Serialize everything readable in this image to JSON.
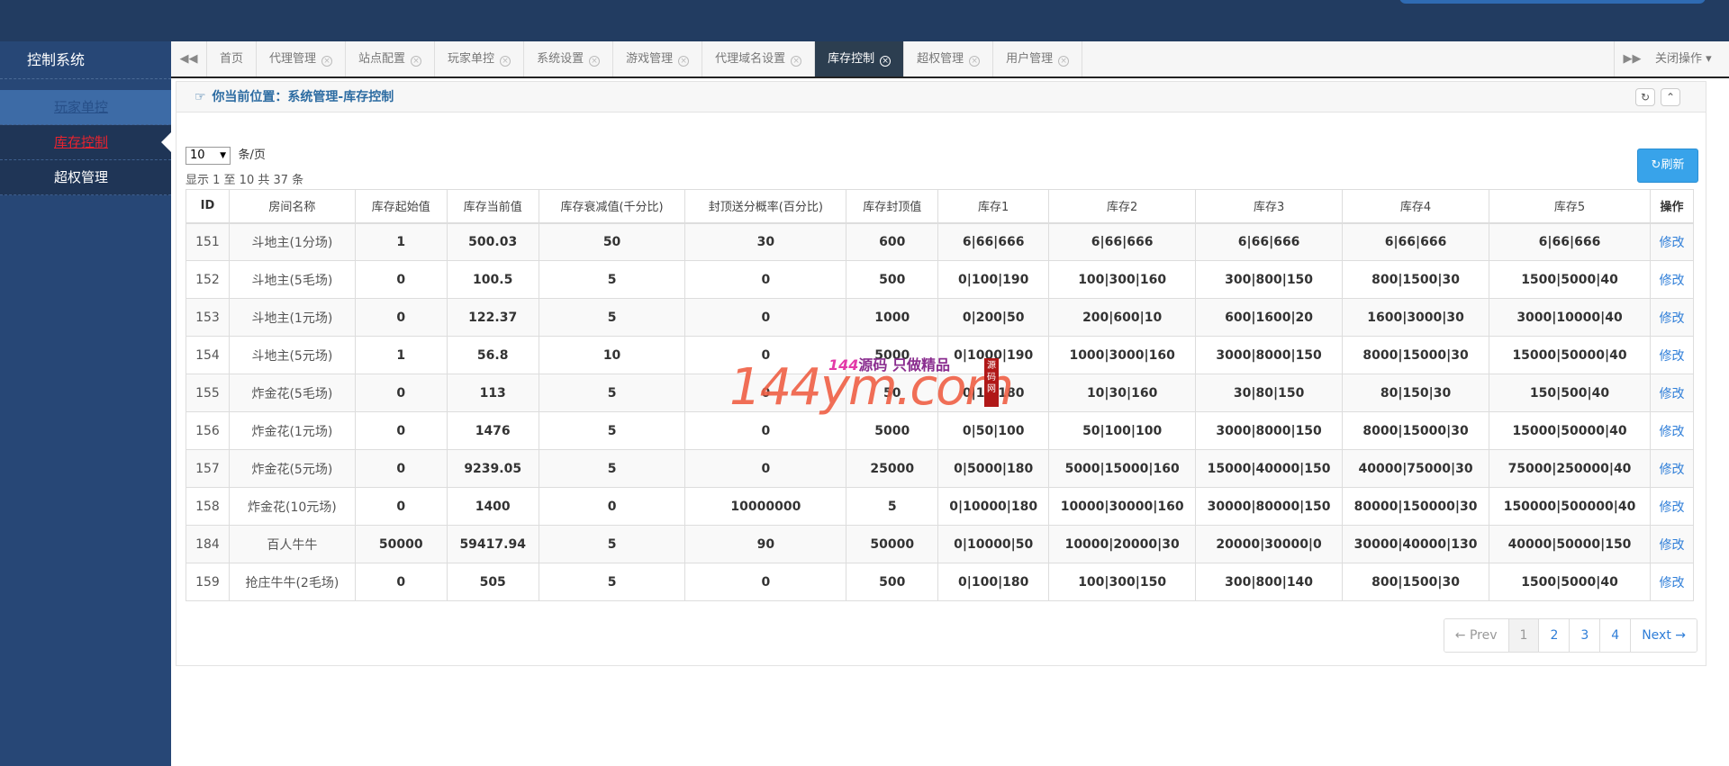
{
  "sidebar": {
    "title": "控制系统",
    "items": [
      {
        "label": "玩家单控"
      },
      {
        "label": "库存控制"
      },
      {
        "label": "超权管理"
      }
    ]
  },
  "tabs": {
    "items": [
      {
        "label": "首页"
      },
      {
        "label": "代理管理"
      },
      {
        "label": "站点配置"
      },
      {
        "label": "玩家单控"
      },
      {
        "label": "系统设置"
      },
      {
        "label": "游戏管理"
      },
      {
        "label": "代理域名设置"
      },
      {
        "label": "库存控制"
      },
      {
        "label": "超权管理"
      },
      {
        "label": "用户管理"
      }
    ],
    "close_ops": "关闭操作",
    "prev_icon": "double-left-arrow-icon",
    "next_icon": "double-right-arrow-icon"
  },
  "panel": {
    "breadcrumb": "你当前位置：系统管理-库存控制",
    "page_size": "10",
    "per_page": "条/页",
    "info": "显示 1 至 10 共 37 条",
    "refresh": "刷新"
  },
  "table": {
    "headers": [
      "ID",
      "房间名称",
      "库存起始值",
      "库存当前值",
      "库存衰减值(千分比)",
      "封顶送分概率(百分比)",
      "库存封顶值",
      "库存1",
      "库存2",
      "库存3",
      "库存4",
      "库存5",
      "操作"
    ],
    "rows": [
      [
        "151",
        "斗地主(1分场)",
        "1",
        "500.03",
        "50",
        "30",
        "600",
        "6|66|666",
        "6|66|666",
        "6|66|666",
        "6|66|666",
        "6|66|666",
        "修改"
      ],
      [
        "152",
        "斗地主(5毛场)",
        "0",
        "100.5",
        "5",
        "0",
        "500",
        "0|100|190",
        "100|300|160",
        "300|800|150",
        "800|1500|30",
        "1500|5000|40",
        "修改"
      ],
      [
        "153",
        "斗地主(1元场)",
        "0",
        "122.37",
        "5",
        "0",
        "1000",
        "0|200|50",
        "200|600|10",
        "600|1600|20",
        "1600|3000|30",
        "3000|10000|40",
        "修改"
      ],
      [
        "154",
        "斗地主(5元场)",
        "1",
        "56.8",
        "10",
        "0",
        "5000",
        "0|1000|190",
        "1000|3000|160",
        "3000|8000|150",
        "8000|15000|30",
        "15000|50000|40",
        "修改"
      ],
      [
        "155",
        "炸金花(5毛场)",
        "0",
        "113",
        "5",
        "0",
        "50",
        "0|10|180",
        "10|30|160",
        "30|80|150",
        "80|150|30",
        "150|500|40",
        "修改"
      ],
      [
        "156",
        "炸金花(1元场)",
        "0",
        "1476",
        "5",
        "0",
        "5000",
        "0|50|100",
        "50|100|100",
        "3000|8000|150",
        "8000|15000|30",
        "15000|50000|40",
        "修改"
      ],
      [
        "157",
        "炸金花(5元场)",
        "0",
        "9239.05",
        "5",
        "0",
        "25000",
        "0|5000|180",
        "5000|15000|160",
        "15000|40000|150",
        "40000|75000|30",
        "75000|250000|40",
        "修改"
      ],
      [
        "158",
        "炸金花(10元场)",
        "0",
        "1400",
        "0",
        "10000000",
        "5",
        "0|10000|180",
        "10000|30000|160",
        "30000|80000|150",
        "80000|150000|30",
        "150000|500000|40",
        "修改"
      ],
      [
        "184",
        "百人牛牛",
        "50000",
        "59417.94",
        "5",
        "90",
        "50000",
        "0|10000|50",
        "10000|20000|30",
        "20000|30000|0",
        "30000|40000|130",
        "40000|50000|150",
        "修改"
      ],
      [
        "159",
        "抢庄牛牛(2毛场)",
        "0",
        "505",
        "5",
        "0",
        "500",
        "0|100|180",
        "100|300|150",
        "300|800|140",
        "800|1500|30",
        "1500|5000|40",
        "修改"
      ]
    ]
  },
  "pager": {
    "prev": "← Prev",
    "pages": [
      "1",
      "2",
      "3",
      "4"
    ],
    "next": "Next →"
  },
  "watermark": {
    "big": "144ym.com",
    "small_pink": "144",
    "small_text": "源码 只做精品",
    "seal": "源码网"
  }
}
